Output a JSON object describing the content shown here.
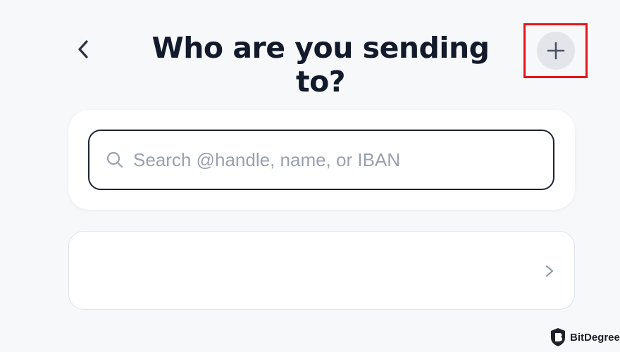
{
  "header": {
    "title": "Who are you sending to?",
    "back_icon": "chevron-left-icon",
    "add_icon": "plus-icon"
  },
  "search": {
    "placeholder": "Search @handle, name, or IBAN",
    "value": "",
    "icon": "search-icon"
  },
  "recipient_row": {
    "label": "",
    "icon": "chevron-right-icon"
  },
  "watermark": {
    "text": "BitDegree"
  },
  "colors": {
    "background": "#f7f8fa",
    "title": "#121a2b",
    "highlight": "#e3161b",
    "add_button_bg": "#e3e5ea",
    "card": "#ffffff",
    "placeholder": "#9aa1ad"
  }
}
